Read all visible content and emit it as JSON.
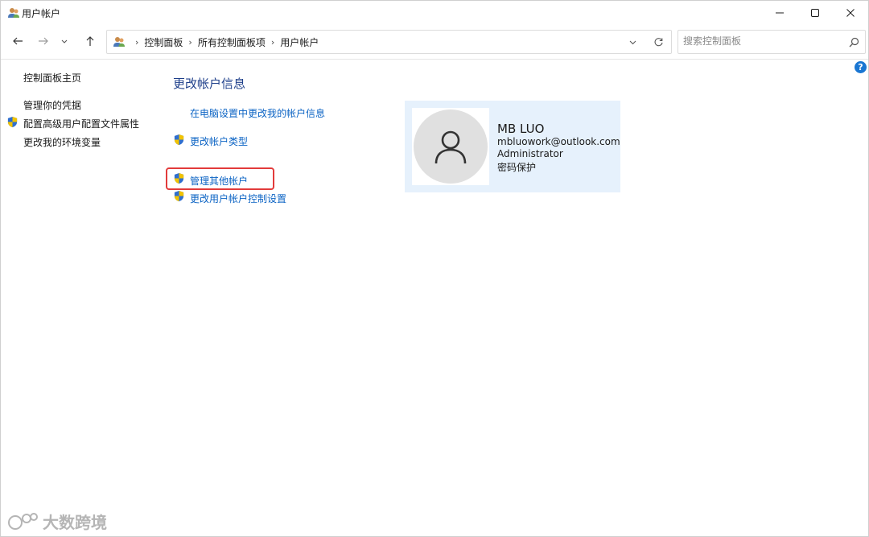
{
  "window": {
    "title": "用户帐户",
    "controls": {
      "minimize": "minimize",
      "maximize": "maximize",
      "close": "close"
    }
  },
  "nav": {
    "breadcrumbs": [
      "控制面板",
      "所有控制面板项",
      "用户帐户"
    ],
    "search_placeholder": "搜索控制面板"
  },
  "sidebar": {
    "items": [
      {
        "label": "控制面板主页",
        "shield": false
      },
      {
        "label": "管理你的凭据",
        "shield": false
      },
      {
        "label": "配置高级用户配置文件属性",
        "shield": true
      },
      {
        "label": "更改我的环境变量",
        "shield": false
      }
    ]
  },
  "main": {
    "heading": "更改帐户信息",
    "links": [
      {
        "label": "在电脑设置中更改我的帐户信息",
        "shield": false
      },
      {
        "label": "更改帐户类型",
        "shield": true
      },
      {
        "label": "管理其他帐户",
        "shield": true,
        "highlighted": true
      },
      {
        "label": "更改用户帐户控制设置",
        "shield": true
      }
    ]
  },
  "account": {
    "name": "MB LUO",
    "email": "mbluowork@outlook.com",
    "role": "Administrator",
    "protection": "密码保护"
  },
  "help_label": "?",
  "watermark": "大数跨境",
  "colors": {
    "link": "#0b63c4",
    "heading": "#1e3f8a",
    "card_bg": "#e6f1fc",
    "highlight_border": "#e23b3b",
    "help_bg": "#1a76d2"
  }
}
